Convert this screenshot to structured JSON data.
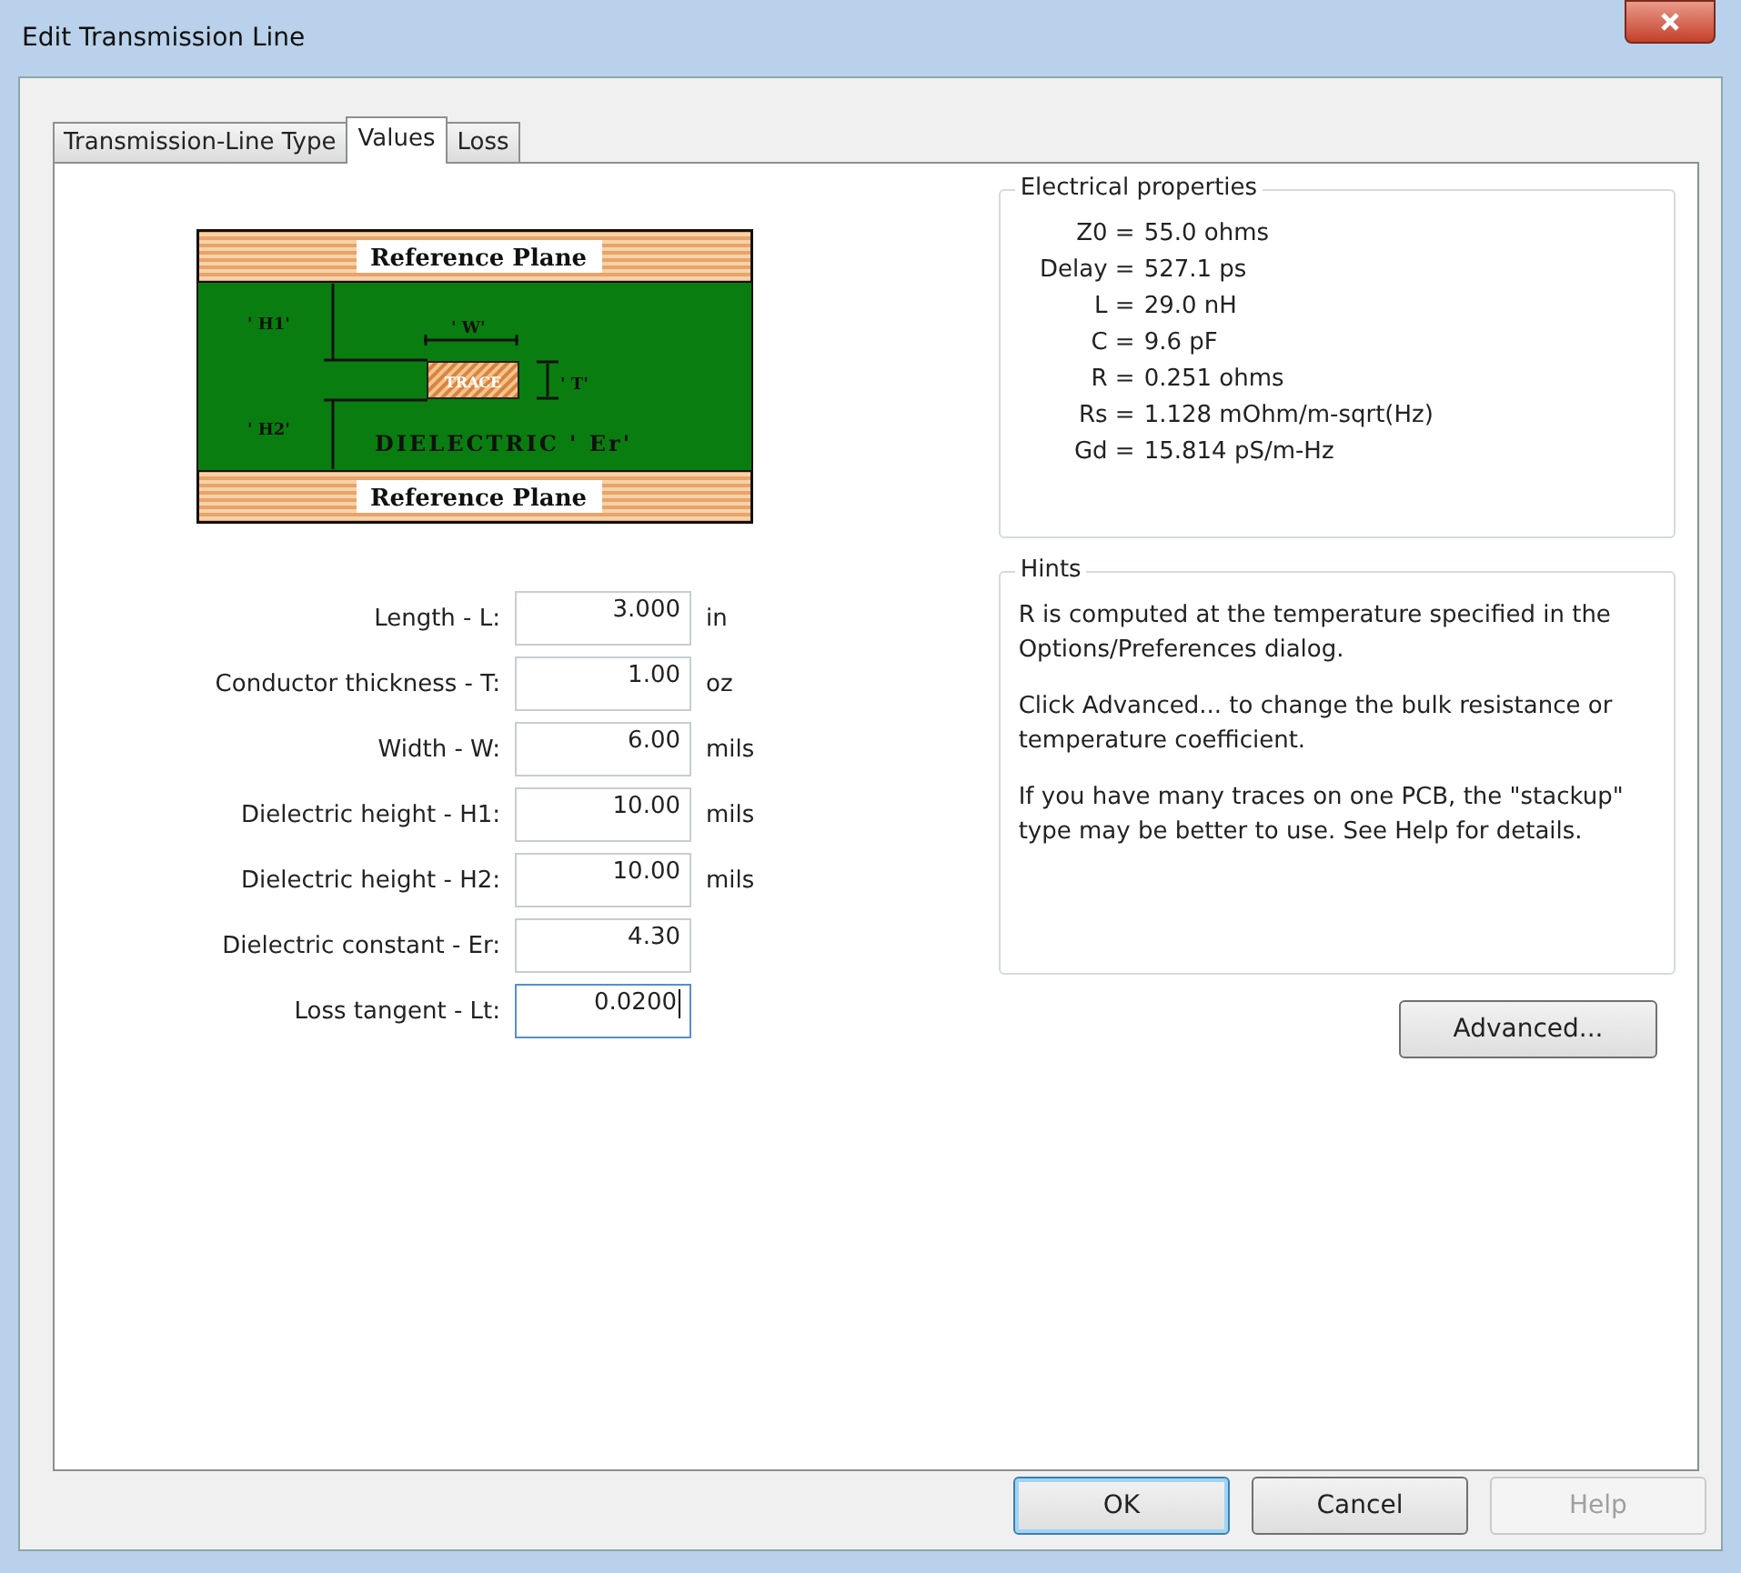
{
  "window": {
    "title": "Edit Transmission Line"
  },
  "tabs": [
    {
      "label": "Transmission-Line Type",
      "selected": false
    },
    {
      "label": "Values",
      "selected": true
    },
    {
      "label": "Loss",
      "selected": false
    }
  ],
  "diagram": {
    "top_plane": "Reference Plane",
    "bottom_plane": "Reference Plane",
    "h1": "' H1'",
    "w": "' W'",
    "trace": "TRACE",
    "t": "' T'",
    "h2": "' H2'",
    "dielectric": "DIELECTRIC ' Er'"
  },
  "fields": [
    {
      "label": "Length - L:",
      "value": "3.000",
      "unit": "in",
      "focused": false
    },
    {
      "label": "Conductor thickness - T:",
      "value": "1.00",
      "unit": "oz",
      "focused": false
    },
    {
      "label": "Width - W:",
      "value": "6.00",
      "unit": "mils",
      "focused": false
    },
    {
      "label": "Dielectric height - H1:",
      "value": "10.00",
      "unit": "mils",
      "focused": false
    },
    {
      "label": "Dielectric height - H2:",
      "value": "10.00",
      "unit": "mils",
      "focused": false
    },
    {
      "label": "Dielectric constant - Er:",
      "value": "4.30",
      "focused": false
    },
    {
      "label": "Loss tangent - Lt:",
      "value": "0.0200",
      "focused": true
    }
  ],
  "electrical_properties": {
    "title": "Electrical properties",
    "rows": [
      {
        "label": "Z0 =",
        "value": "55.0 ohms"
      },
      {
        "label": "Delay =",
        "value": "527.1 ps"
      },
      {
        "label": "L =",
        "value": "29.0 nH"
      },
      {
        "label": "C =",
        "value": "9.6 pF"
      },
      {
        "label": "R =",
        "value": "0.251 ohms"
      },
      {
        "label": "Rs =",
        "value": "1.128 mOhm/m-sqrt(Hz)"
      },
      {
        "label": "Gd =",
        "value": "15.814 pS/m-Hz"
      }
    ]
  },
  "hints": {
    "title": "Hints",
    "paragraphs": [
      "R is computed at the temperature specified in the Options/Preferences dialog.",
      "Click Advanced... to change the bulk resistance or temperature coefficient.",
      "If you have many traces on one PCB, the \"stackup\" type may be better to use.  See Help for details."
    ]
  },
  "advanced_button": {
    "label": "Advanced..."
  },
  "buttons": [
    {
      "label": "OK",
      "default": true,
      "disabled": false
    },
    {
      "label": "Cancel",
      "default": false,
      "disabled": false
    },
    {
      "label": "Help",
      "default": false,
      "disabled": true
    }
  ]
}
